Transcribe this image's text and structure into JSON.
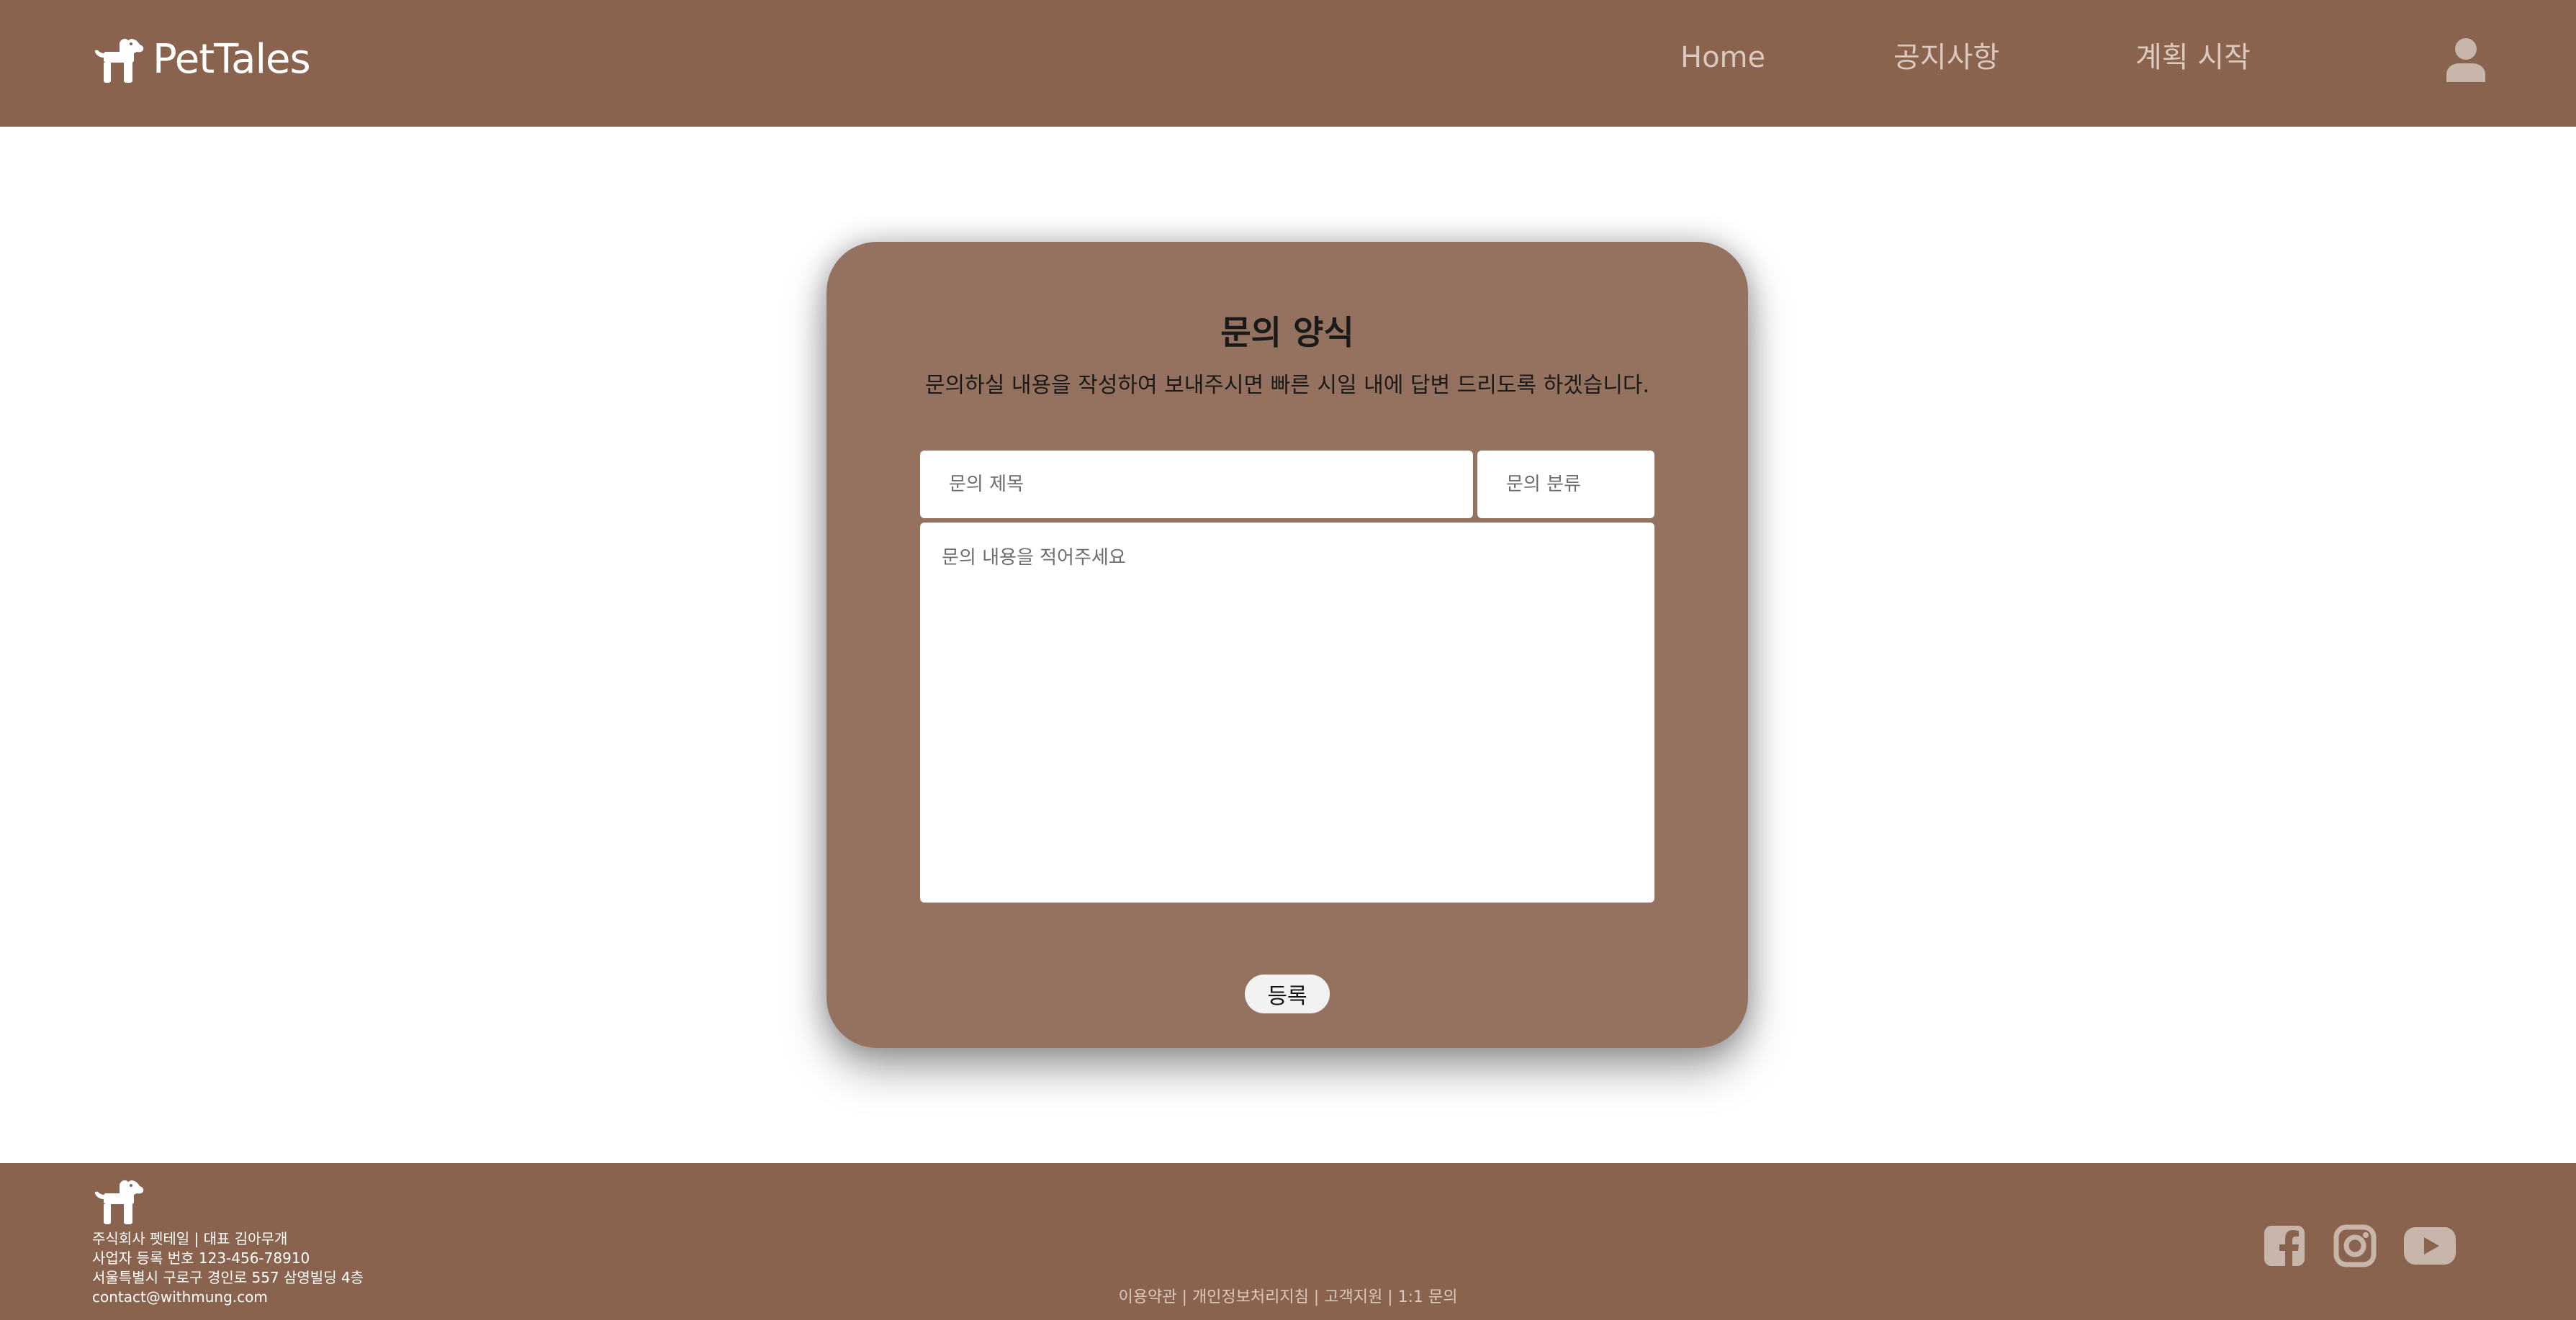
{
  "colors": {
    "header_bg": "#8a634e",
    "card_bg": "#94725f",
    "nav_text": "#dbc9bf",
    "icon_color": "#c9b6ab"
  },
  "header": {
    "brand": "PetTales",
    "logo_icon": "dog-icon",
    "nav": {
      "home": "Home",
      "notice": "공지사항",
      "plan": "계획 시작"
    },
    "user_icon": "user-icon"
  },
  "form": {
    "title": "문의 양식",
    "subtitle": "문의하실 내용을 작성하여 보내주시면 빠른 시일 내에 답변 드리도록 하겠습니다.",
    "subject_placeholder": "문의 제목",
    "category_placeholder": "문의 분류",
    "content_placeholder": "문의 내용을 적어주세요",
    "submit_label": "등록"
  },
  "footer": {
    "company_line1": "주식회사 펫테일 | 대표 김아무개",
    "company_line2": "사업자 등록 번호 123-456-78910",
    "company_line3": "서울특별시 구로구 경인로 557 삼영빌딩 4층",
    "email": "contact@withmung.com",
    "links": {
      "terms": "이용약관",
      "privacy": "개인정보처리지침",
      "support": "고객지원",
      "inquiry": "1:1 문의"
    },
    "separator": " | ",
    "social": [
      "facebook-icon",
      "instagram-icon",
      "youtube-icon"
    ]
  }
}
